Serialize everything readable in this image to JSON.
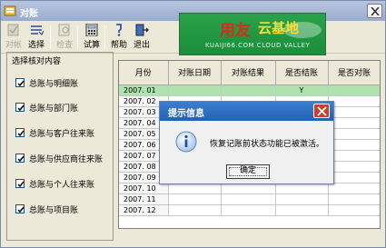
{
  "window": {
    "title": "对账"
  },
  "toolbar": {
    "buttons": [
      {
        "id": "reconcile",
        "label": "对帐",
        "icon": "reconcile-icon",
        "enabled": false
      },
      {
        "id": "select",
        "label": "选择",
        "icon": "select-list-icon",
        "enabled": true
      },
      {
        "id": "check",
        "label": "检查",
        "icon": "check-icon",
        "enabled": false
      },
      {
        "id": "trial",
        "label": "试算",
        "icon": "calculator-icon",
        "enabled": true
      },
      {
        "id": "help",
        "label": "帮助",
        "icon": "help-icon",
        "enabled": true
      },
      {
        "id": "exit",
        "label": "退出",
        "icon": "exit-icon",
        "enabled": true
      }
    ]
  },
  "banner": {
    "main": "用友",
    "sub": "云基地",
    "en": "KUAIJI66.COM CLOUD VALLEY"
  },
  "panel": {
    "title": "选择核对内容",
    "items": [
      {
        "label": "总账与明细账",
        "checked": true
      },
      {
        "label": "总账与部门账",
        "checked": true
      },
      {
        "label": "总账与客户往来账",
        "checked": true
      },
      {
        "label": "总账与供应商往来账",
        "checked": true
      },
      {
        "label": "总账与个人往来账",
        "checked": true
      },
      {
        "label": "总账与项目账",
        "checked": true
      }
    ]
  },
  "table": {
    "headers": [
      "月份",
      "对账日期",
      "对账结果",
      "是否结账",
      "是否对账"
    ],
    "rows": [
      [
        "2007. 01",
        "",
        "",
        "Y",
        ""
      ],
      [
        "2007. 02",
        "",
        "",
        "",
        ""
      ],
      [
        "2007. 03",
        "",
        "",
        "",
        ""
      ],
      [
        "2007. 04",
        "",
        "",
        "",
        ""
      ],
      [
        "2007. 05",
        "",
        "",
        "",
        ""
      ],
      [
        "2007. 06",
        "",
        "",
        "",
        ""
      ],
      [
        "2007. 07",
        "",
        "",
        "",
        ""
      ],
      [
        "2007. 08",
        "",
        "",
        "",
        ""
      ],
      [
        "2007. 09",
        "",
        "",
        "",
        ""
      ],
      [
        "2007. 10",
        "",
        "",
        "",
        ""
      ],
      [
        "2007. 11",
        "",
        "",
        "",
        ""
      ],
      [
        "2007. 12",
        "",
        "",
        "",
        ""
      ]
    ],
    "selected_row": 0
  },
  "dialog": {
    "title": "提示信息",
    "message": "恢复记账前状态功能已被激活。",
    "ok_label": "确定"
  },
  "colors": {
    "title_bar": "#9aaccd",
    "dialog_title": "#2361b3",
    "selected_row": "#aee3ae",
    "banner": "#1b8d3b"
  }
}
